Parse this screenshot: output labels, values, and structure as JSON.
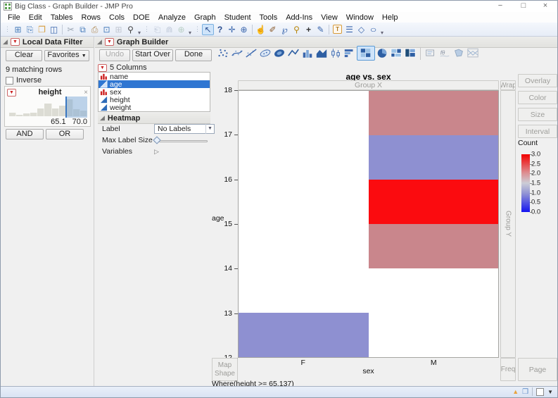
{
  "window": {
    "title": "Big Class - Graph Builder - JMP Pro",
    "controls": {
      "minimize": "−",
      "maximize": "□",
      "close": "×"
    }
  },
  "menu": {
    "items": [
      "File",
      "Edit",
      "Tables",
      "Rows",
      "Cols",
      "DOE",
      "Analyze",
      "Graph",
      "Student",
      "Tools",
      "Add-Ins",
      "View",
      "Window",
      "Help"
    ]
  },
  "toolbar": {
    "groups": [
      [
        "new-data-table-icon",
        "import-icon",
        "open-icon",
        "save-icon"
      ],
      [
        "cut-icon",
        "copy-icon",
        "paste-icon",
        "journal-icon",
        "lock-icon",
        "search-icon"
      ],
      [
        "edit-journal-icon",
        "find-icon",
        "add-to-journal-icon"
      ],
      [
        "arrow-icon",
        "help-icon",
        "move-icon",
        "crosshair-icon"
      ],
      [
        "hand-icon",
        "brush-icon",
        "lasso-icon",
        "magnifier-icon",
        "plus-icon",
        "annotate-icon"
      ],
      [
        "text-note-icon",
        "lines-icon",
        "polygon-icon",
        "oval-icon"
      ]
    ],
    "selected_tool": "arrow-icon"
  },
  "filter_panel": {
    "title": "Local Data Filter",
    "clear_label": "Clear",
    "favorites_label": "Favorites",
    "matching_text": "9 matching rows",
    "inverse_label": "Inverse",
    "and_label": "AND",
    "or_label": "OR",
    "field": {
      "name": "height",
      "close_glyph": "×",
      "range_low": "65.1",
      "range_high": "70.0",
      "histogram": [
        0.2,
        0.07,
        0.14,
        0.2,
        0.42,
        0.7,
        0.44,
        0.58,
        0.92,
        0.4,
        0.3
      ],
      "selection_start_frac": 0.72
    }
  },
  "builder_panel": {
    "title": "Graph Builder",
    "undo_label": "Undo",
    "start_over_label": "Start Over",
    "done_label": "Done",
    "columns_header": "5 Columns",
    "columns": [
      {
        "name": "name",
        "type": "nominal",
        "selected": false
      },
      {
        "name": "age",
        "type": "continuous",
        "selected": true
      },
      {
        "name": "sex",
        "type": "nominal",
        "selected": false
      },
      {
        "name": "height",
        "type": "continuous",
        "selected": false
      },
      {
        "name": "weight",
        "type": "continuous",
        "selected": false
      }
    ],
    "heatmap_section": {
      "title": "Heatmap",
      "label_label": "Label",
      "label_value": "No Labels",
      "max_label_size_label": "Max Label Size",
      "variables_label": "Variables"
    }
  },
  "palette": {
    "icons": [
      "points-icon",
      "smoother-icon",
      "line-of-fit-icon",
      "ellipse-icon",
      "contour-icon",
      "line-icon",
      "bar-icon",
      "area-icon",
      "box-plot-icon",
      "histogram-icon",
      "heatmap-icon",
      "pie-icon",
      "treemap-icon",
      "mosaic-icon",
      "caption-box-icon",
      "formula-icon",
      "map-shapes-icon",
      "parallel-plot-icon"
    ],
    "separator_after": "mosaic-icon",
    "selected": "heatmap-icon"
  },
  "chart": {
    "zones": {
      "group_x": "Group X",
      "wrap": "Wrap",
      "group_y": "Group Y",
      "map_shape": "Map Shape",
      "freq": "Freq",
      "page": "Page",
      "overlay": "Overlay",
      "color": "Color",
      "size": "Size",
      "interval": "Interval"
    },
    "where_text": "Where(height >= 65.137)"
  },
  "chart_data": {
    "type": "heatmap",
    "title": "age vs. sex",
    "xlabel": "sex",
    "ylabel": "age",
    "x_categories": [
      "F",
      "M"
    ],
    "y_ticks": [
      12,
      13,
      14,
      15,
      16,
      17,
      18
    ],
    "ylim": [
      12,
      18
    ],
    "cells": [
      {
        "x": "F",
        "y_from": 12,
        "y_to": 13,
        "count": 1,
        "color": "#8e90d1"
      },
      {
        "x": "M",
        "y_from": 14,
        "y_to": 15,
        "count": 2,
        "color": "#c9868c"
      },
      {
        "x": "M",
        "y_from": 15,
        "y_to": 16,
        "count": 3,
        "color": "#fb0b0f"
      },
      {
        "x": "M",
        "y_from": 16,
        "y_to": 17,
        "count": 1,
        "color": "#8e90d1"
      },
      {
        "x": "M",
        "y_from": 17,
        "y_to": 18,
        "count": 2,
        "color": "#c9868c"
      }
    ],
    "legend": {
      "title": "Count",
      "ticks": [
        "3.0",
        "2.5",
        "2.0",
        "1.5",
        "1.0",
        "0.5",
        "0.0"
      ],
      "range": [
        0,
        3
      ],
      "gradient": [
        "#1414f0",
        "#cccdd6",
        "#f20000"
      ],
      "position": "right"
    }
  },
  "statusbar": {
    "icons": [
      "home-icon",
      "window-icon",
      "checkbox-icon",
      "dropdown-icon"
    ]
  }
}
